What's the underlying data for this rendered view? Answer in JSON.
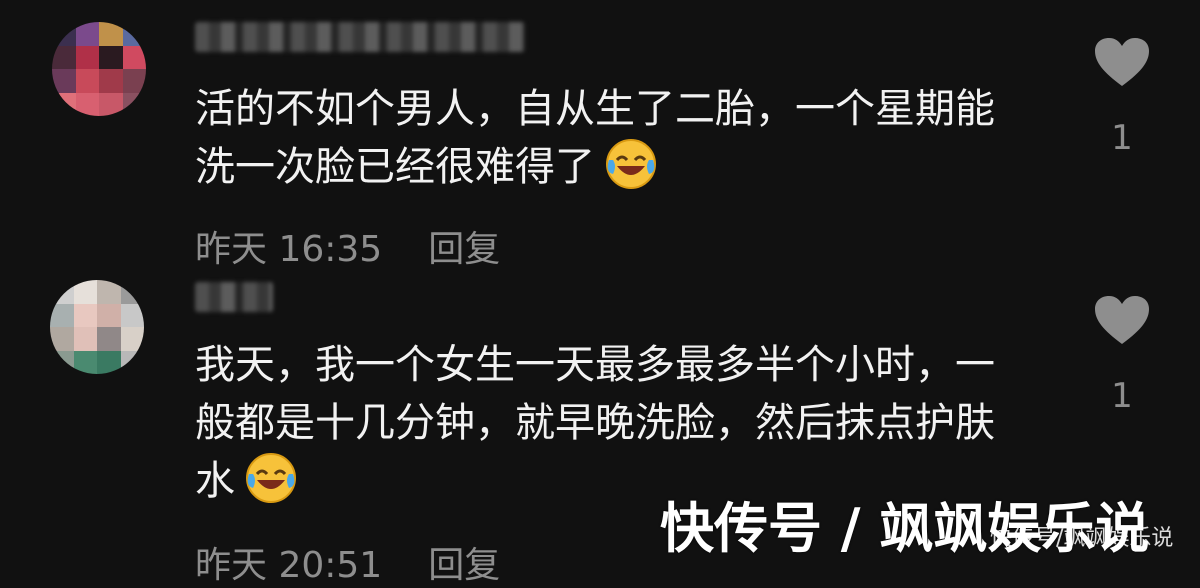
{
  "comments": [
    {
      "text": "活的不如个男人，自从生了二胎，一个星期能洗一次脸已经很难得了",
      "emoji": "laughing-crying-emoji",
      "time": "昨天 16:35",
      "reply_label": "回复",
      "like_count": "1"
    },
    {
      "text": "我天，我一个女生一天最多最多半个小时，一般都是十几分钟，就早晚洗脸，然后抹点护肤水",
      "emoji": "laughing-crying-emoji",
      "time": "昨天 20:51",
      "reply_label": "回复",
      "like_count": "1"
    }
  ],
  "watermark": {
    "text": "快传号 / 飒飒娱乐说",
    "sub_text": "快传号/飒飒娱乐说"
  },
  "colors": {
    "background": "#111111",
    "text": "#f2f2f2",
    "meta": "#8e8e8e",
    "heart": "#8e8e8e"
  }
}
